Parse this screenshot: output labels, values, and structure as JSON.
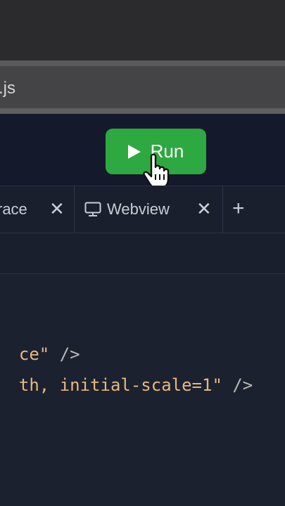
{
  "editor": {
    "file_tab": ".js"
  },
  "toolbar": {
    "run_label": "Run"
  },
  "panel_tabs": [
    {
      "label": "race",
      "close": "✕"
    },
    {
      "label": "Webview",
      "close": "✕"
    }
  ],
  "add_tab": "+",
  "code_lines": [
    {
      "str": "ce\"",
      "rest": " />"
    },
    {
      "str": "th, initial-scale=1\"",
      "rest": " />"
    }
  ],
  "icons": {
    "play": "play-icon",
    "monitor": "monitor-icon",
    "cursor": "hand-pointer-icon"
  },
  "colors": {
    "run_button": "#2ea840",
    "string": "#e5b97e",
    "background": "#1c2130"
  }
}
